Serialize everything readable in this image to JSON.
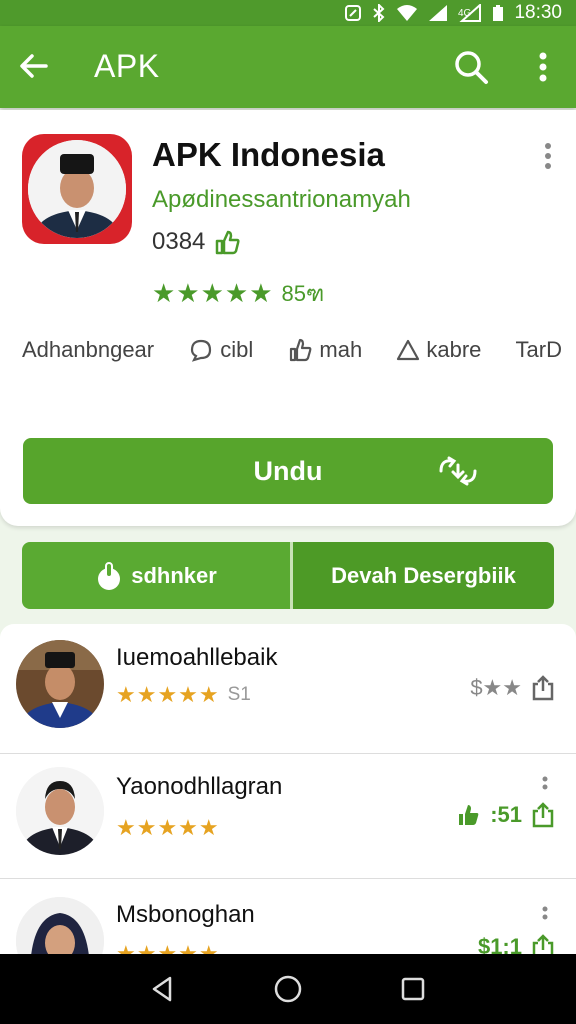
{
  "status_bar": {
    "time": "18:30",
    "icons": [
      "nfc-icon",
      "bluetooth-icon",
      "wifi-icon",
      "signal-icon",
      "signal-4g-icon",
      "battery-icon"
    ]
  },
  "app_bar": {
    "title": "APK",
    "back_icon": "arrow-left-icon",
    "search_icon": "search-icon",
    "menu_icon": "more-vert-icon"
  },
  "app": {
    "name": "APK Indonesia",
    "developer": "Apødinessantrionamyah",
    "meta": "0384",
    "stars": "★★★★★",
    "rating_count": "85ฑ"
  },
  "chips": [
    {
      "label": "Adhanbngear",
      "icon": ""
    },
    {
      "label": "cibl",
      "icon": "chat-icon"
    },
    {
      "label": "mah",
      "icon": "thumb-icon"
    },
    {
      "label": "kabre",
      "icon": "triangle-icon"
    },
    {
      "label": "TarD",
      "icon": ""
    }
  ],
  "download": {
    "label": "Undu",
    "icon": "download-sync-icon"
  },
  "actions": {
    "left_label": "sdhnker",
    "right_label": "Devah Desergbiik"
  },
  "reviews": [
    {
      "name": "Iuemoahllebaik",
      "stars": "★★★★★",
      "count": "S1",
      "right_text": "$★★",
      "avatar": "man-peci-avatar"
    },
    {
      "name": "Yaonodhllagran",
      "stars": "★★★★★",
      "count": "",
      "right_text": ":51",
      "avatar": "man-suit-avatar"
    },
    {
      "name": "Msbonoghan",
      "stars": "★★★★★",
      "count": "",
      "right_text": "$1:1",
      "avatar": "woman-hijab-avatar"
    }
  ],
  "colors": {
    "primary": "#5aa830",
    "primary_dark": "#4f9a2c",
    "star_green": "#4a9a2a",
    "star_gold": "#e6a321"
  }
}
